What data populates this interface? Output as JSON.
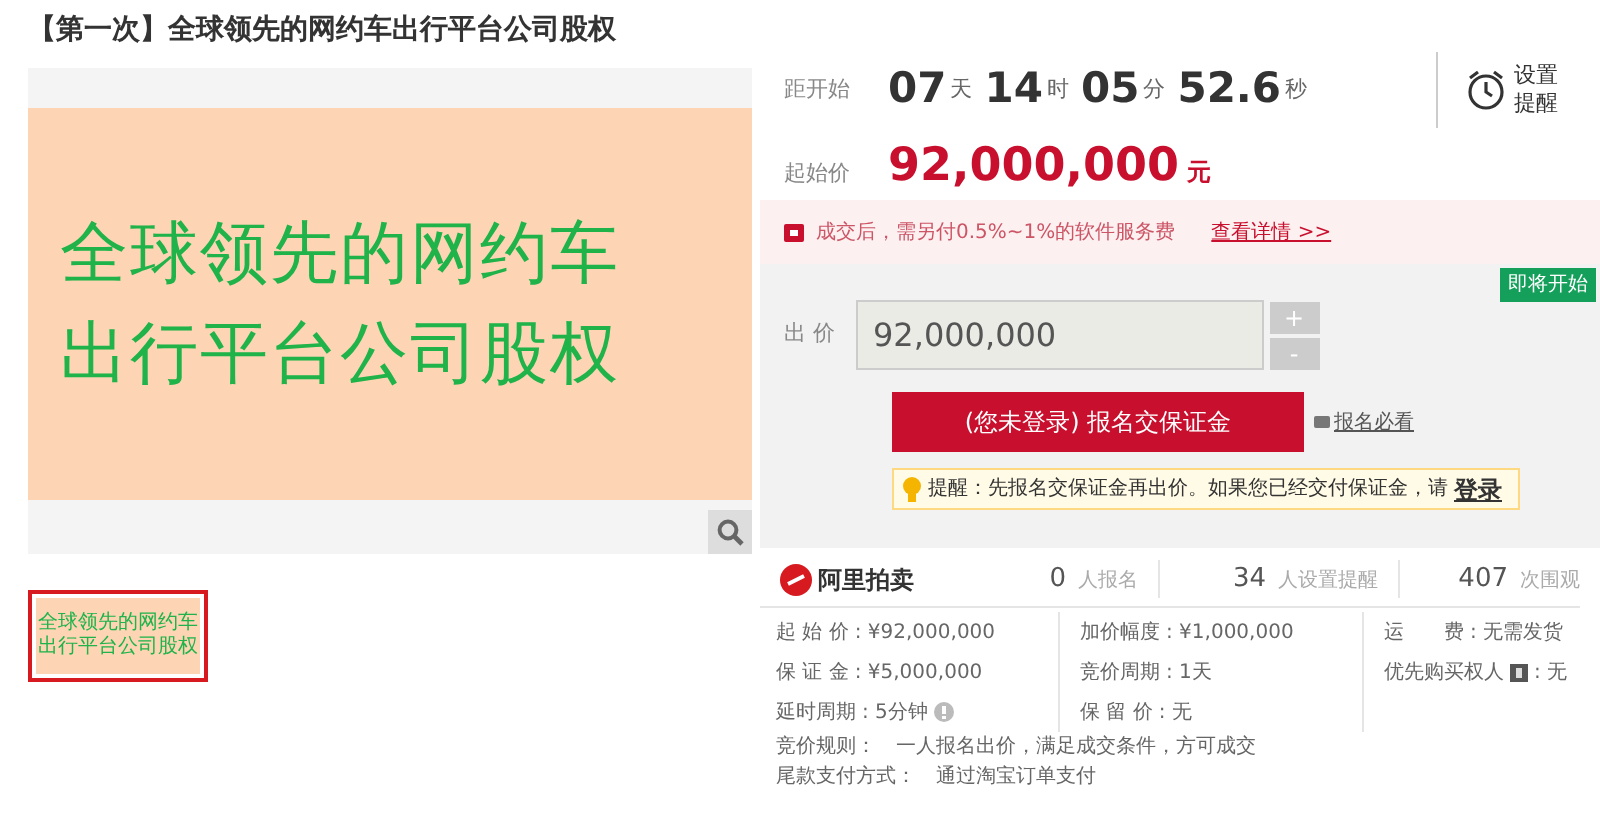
{
  "title": "【第一次】全球领先的网约车出行平台公司股权",
  "gallery": {
    "main_lines": [
      "全球领先的网约车",
      "出行平台公司股权"
    ],
    "thumbnails": [
      {
        "lines": [
          "全球领先的网约车",
          "出行平台公司股权"
        ],
        "selected": true
      }
    ]
  },
  "countdown": {
    "label": "距开始",
    "parts": [
      {
        "value": "07",
        "unit": "天"
      },
      {
        "value": "14",
        "unit": "时"
      },
      {
        "value": "05",
        "unit": "分"
      },
      {
        "value": "52.6",
        "unit": "秒"
      }
    ]
  },
  "reminder": {
    "lines": [
      "设置",
      "提醒"
    ]
  },
  "start_price": {
    "label": "起始价",
    "value": "92,000,000",
    "unit": "元"
  },
  "notice": {
    "text": "成交后，需另付0.5%~1%的软件服务费",
    "link": "查看详情 >>"
  },
  "status_badge": "即将开始",
  "bid": {
    "label": "出 价",
    "value": "92,000,000",
    "plus": "+",
    "minus": "-"
  },
  "register_button": "(您未登录) 报名交保证金",
  "must_read": "报名必看",
  "tip": {
    "text": "提醒：先报名交保证金再出价。如果您已经交付保证金，请",
    "link": "登录"
  },
  "brand": "阿里拍卖",
  "stats": [
    {
      "value": "0",
      "label": "人报名"
    },
    {
      "value": "34",
      "label": "人设置提醒"
    },
    {
      "value": "407",
      "label": "次围观"
    }
  ],
  "details": [
    [
      {
        "label": "起 始 价",
        "value": ": ¥92,000,000"
      },
      {
        "label": "保 证 金",
        "value": ": ¥5,000,000"
      },
      {
        "label": "延时周期",
        "value": ": 5分钟",
        "help": true
      }
    ],
    [
      {
        "label": "加价幅度",
        "value": ": ¥1,000,000"
      },
      {
        "label": "竞价周期",
        "value": ": 1天"
      },
      {
        "label": "保 留 价",
        "value": ": 无"
      }
    ],
    [
      {
        "label": "运　　费",
        "value": ": 无需发货"
      },
      {
        "label": "优先购买权人",
        "value": ": 无",
        "info": true
      }
    ]
  ],
  "rules": [
    {
      "label": "竞价规则：",
      "value": "一人报名出价，满足成交条件，方可成交"
    },
    {
      "label": "尾款支付方式：",
      "value": "通过淘宝订单支付"
    }
  ]
}
